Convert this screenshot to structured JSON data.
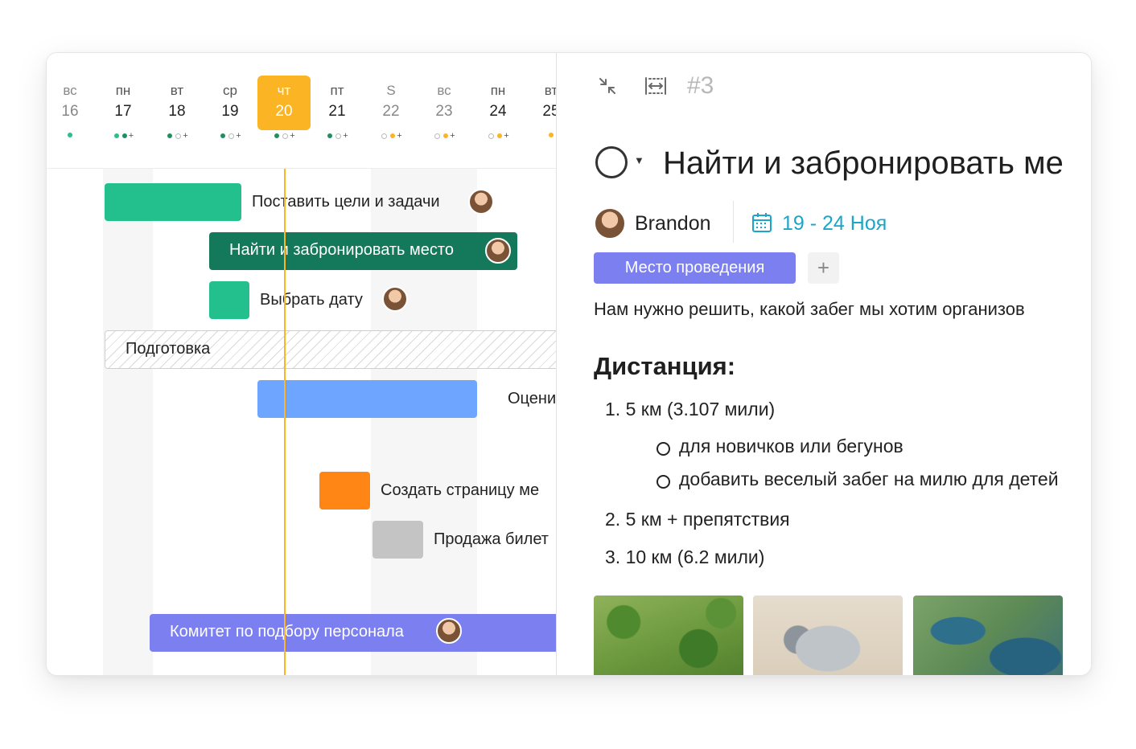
{
  "calendar": {
    "days": [
      {
        "name": "вс",
        "num": "16",
        "muted": true,
        "today": false,
        "dots": [
          "lg"
        ],
        "plus": false
      },
      {
        "name": "пн",
        "num": "17",
        "muted": false,
        "today": false,
        "dots": [
          "lg",
          "g"
        ],
        "plus": true
      },
      {
        "name": "вт",
        "num": "18",
        "muted": false,
        "today": false,
        "dots": [
          "g",
          "o"
        ],
        "plus": true
      },
      {
        "name": "ср",
        "num": "19",
        "muted": false,
        "today": false,
        "dots": [
          "g",
          "o"
        ],
        "plus": true
      },
      {
        "name": "чт",
        "num": "20",
        "muted": false,
        "today": true,
        "dots": [
          "g",
          "o"
        ],
        "plus": true
      },
      {
        "name": "пт",
        "num": "21",
        "muted": false,
        "today": false,
        "dots": [
          "g",
          "o"
        ],
        "plus": true
      },
      {
        "name": "S",
        "num": "22",
        "muted": true,
        "today": false,
        "dots": [
          "o",
          "y"
        ],
        "plus": true
      },
      {
        "name": "вс",
        "num": "23",
        "muted": true,
        "today": false,
        "dots": [
          "o",
          "y"
        ],
        "plus": true
      },
      {
        "name": "пн",
        "num": "24",
        "muted": false,
        "today": false,
        "dots": [
          "o",
          "y"
        ],
        "plus": true
      },
      {
        "name": "вт",
        "num": "25",
        "muted": false,
        "today": false,
        "dots": [
          "y"
        ],
        "plus": false
      }
    ]
  },
  "tasks": [
    {
      "label": "Поставить цели и задачи",
      "color": "#23bf8d"
    },
    {
      "label": "Найти и забронировать место",
      "color": "#14795a"
    },
    {
      "label": "Выбрать дату",
      "color": "#23bf8d"
    },
    {
      "label": "Подготовка",
      "color": "#d9d9d9"
    },
    {
      "label": "Оцени",
      "color": "#6ea6ff"
    },
    {
      "label": "Создать страницу ме",
      "color": "#ff8614"
    },
    {
      "label": "Продажа билет",
      "color": "#c4c4c4"
    },
    {
      "label": "Комитет по подбору персонала",
      "color": "#7b7ff0"
    }
  ],
  "detail": {
    "task_number": "#3",
    "title": "Найти и забронировать ме",
    "owner": "Brandon",
    "dates": "19 - 24 Ноя",
    "tag": "Место проведения",
    "add_tag": "+",
    "description": "Нам нужно решить, какой забег мы хотим организов",
    "heading": "Дистанция:",
    "list": [
      "1. 5 км (3.107 мили)",
      "2. 5 км + препятствия",
      "3. 10 км (6.2 мили)"
    ],
    "sublist": [
      "для новичков или бегунов",
      "добавить веселый забег на милю для детей"
    ]
  },
  "icons": {
    "collapse": "collapse-arrows-icon",
    "fit_width": "fit-width-icon",
    "status": "status-circle-icon",
    "calendar": "calendar-icon"
  },
  "colors": {
    "accent_today": "#fbb424",
    "date_color": "#1aa6c9",
    "tag_color": "#7b7ff0"
  }
}
